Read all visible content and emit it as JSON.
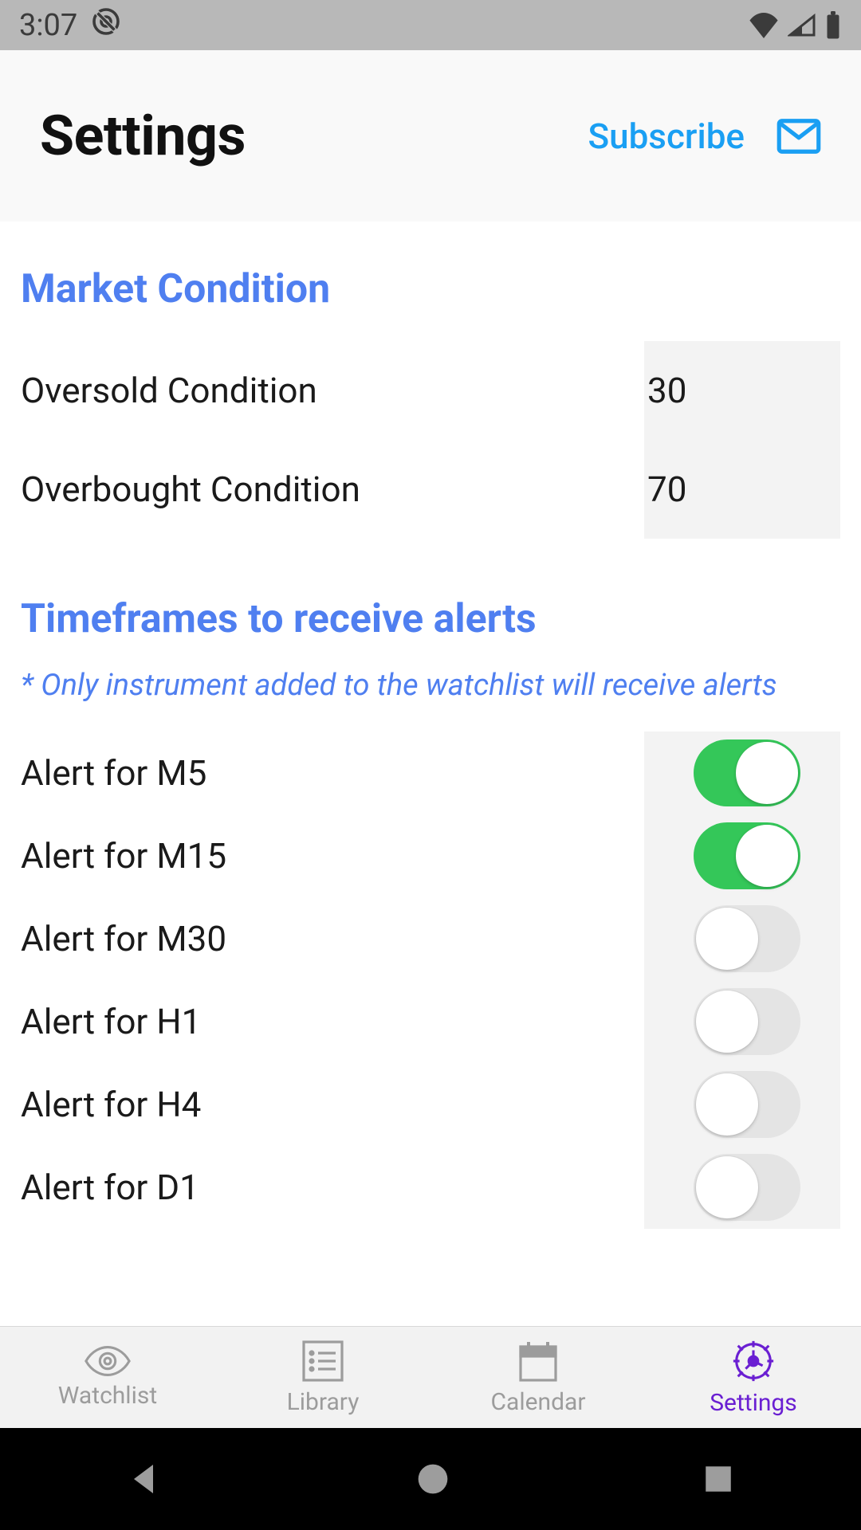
{
  "status": {
    "time": "3:07"
  },
  "header": {
    "title": "Settings",
    "subscribe_label": "Subscribe"
  },
  "market_condition": {
    "title": "Market Condition",
    "rows": [
      {
        "label": "Oversold Condition",
        "value": "30"
      },
      {
        "label": "Overbought Condition",
        "value": "70"
      }
    ]
  },
  "timeframes": {
    "title": "Timeframes to receive alerts",
    "note": "* Only instrument added to the watchlist will receive alerts",
    "rows": [
      {
        "label": "Alert for M5",
        "on": true
      },
      {
        "label": "Alert for M15",
        "on": true
      },
      {
        "label": "Alert for M30",
        "on": false
      },
      {
        "label": "Alert for H1",
        "on": false
      },
      {
        "label": "Alert for H4",
        "on": false
      },
      {
        "label": "Alert for D1",
        "on": false
      }
    ]
  },
  "tabs": {
    "items": [
      {
        "label": "Watchlist",
        "active": false
      },
      {
        "label": "Library",
        "active": false
      },
      {
        "label": "Calendar",
        "active": false
      },
      {
        "label": "Settings",
        "active": true
      }
    ]
  },
  "colors": {
    "accent_blue": "#4f7ff0",
    "link_blue": "#1a9ff3",
    "purple": "#6a1fd2",
    "green": "#34c759"
  }
}
